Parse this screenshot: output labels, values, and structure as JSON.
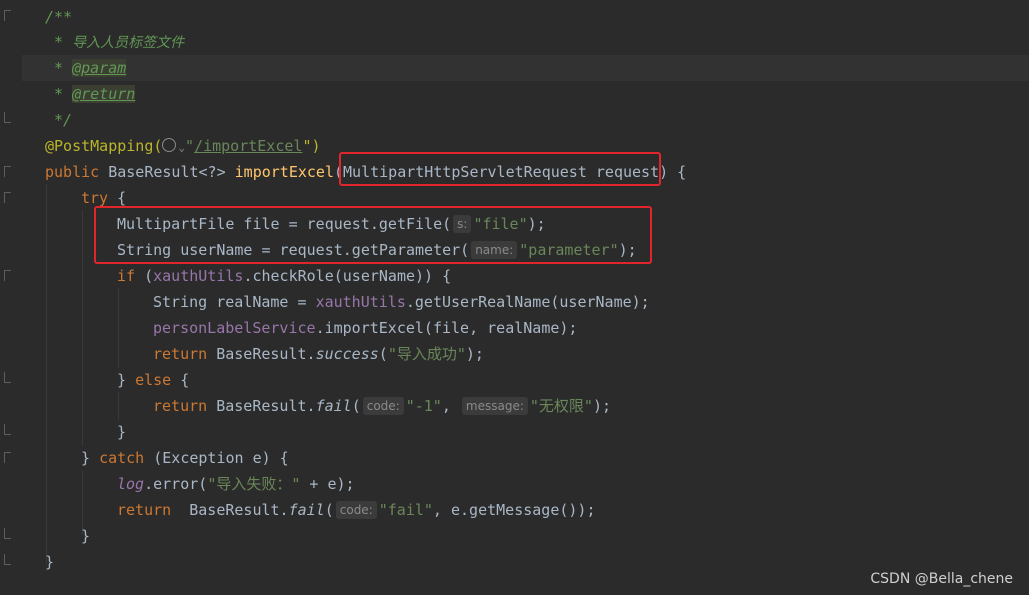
{
  "code": {
    "l1": "/**",
    "l2_prefix": " * ",
    "l2_text": "导入人员标签文件",
    "l3_prefix": " * ",
    "l3_tag": "@param",
    "l4_prefix": " * ",
    "l4_tag": "@return",
    "l5": " */",
    "l6_ann": "@PostMapping(",
    "l6_path": "/importExcel",
    "l6_q1": "\"",
    "l6_q2": "\")",
    "l7_kw": "public ",
    "l7_type": "BaseResult<?> ",
    "l7_fn": "importExcel",
    "l7_params": "(MultipartHttpServletRequest request) {",
    "l8_kw": "try",
    "l8_rest": " {",
    "l9_a": "MultipartFile file = request.getFile(",
    "l9_hint": "s:",
    "l9_str": "\"file\"",
    "l9_end": ");",
    "l10_a": "String userName = request.getParameter(",
    "l10_hint": "name:",
    "l10_str": "\"parameter\"",
    "l10_end": ");",
    "l11_kw": "if",
    "l11_a": " (",
    "l11_field": "xauthUtils",
    "l11_b": ".checkRole(userName)) {",
    "l12_a": "String realName = ",
    "l12_field": "xauthUtils",
    "l12_b": ".getUserRealName(userName);",
    "l13_field": "personLabelService",
    "l13_b": ".importExcel(file, realName);",
    "l14_kw": "return ",
    "l14_a": "BaseResult.",
    "l14_fn": "success",
    "l14_b": "(",
    "l14_str": "\"导入成功\"",
    "l14_end": ");",
    "l15_a": "} ",
    "l15_kw": "else",
    "l15_b": " {",
    "l16_kw": "return ",
    "l16_a": "BaseResult.",
    "l16_fn": "fail",
    "l16_b": "(",
    "l16_hint1": "code:",
    "l16_str1": "\"-1\"",
    "l16_c": ", ",
    "l16_hint2": "message:",
    "l16_str2": "\"无权限\"",
    "l16_end": ");",
    "l17": "}",
    "l18_a": "} ",
    "l18_kw": "catch",
    "l18_b": " (Exception e) {",
    "l19_field": "log",
    "l19_a": ".error(",
    "l19_str": "\"导入失败：\"",
    "l19_b": " + e);",
    "l20_kw": "return ",
    "l20_a": " BaseResult.",
    "l20_fn": "fail",
    "l20_b": "(",
    "l20_hint": "code:",
    "l20_str": "\"fail\"",
    "l20_c": ", e.getMessage());",
    "l21": "}",
    "l22": "}"
  },
  "watermark": "CSDN @Bella_chene",
  "colors": {
    "background": "#2b2b2b",
    "keyword": "#cc7832",
    "string": "#6a8759",
    "comment": "#629755",
    "function": "#ffc66d",
    "field": "#9876aa",
    "annotation": "#bbb529",
    "highlight_box": "#e0262a"
  },
  "icons": [
    "globe-icon",
    "chevron-down-icon"
  ]
}
